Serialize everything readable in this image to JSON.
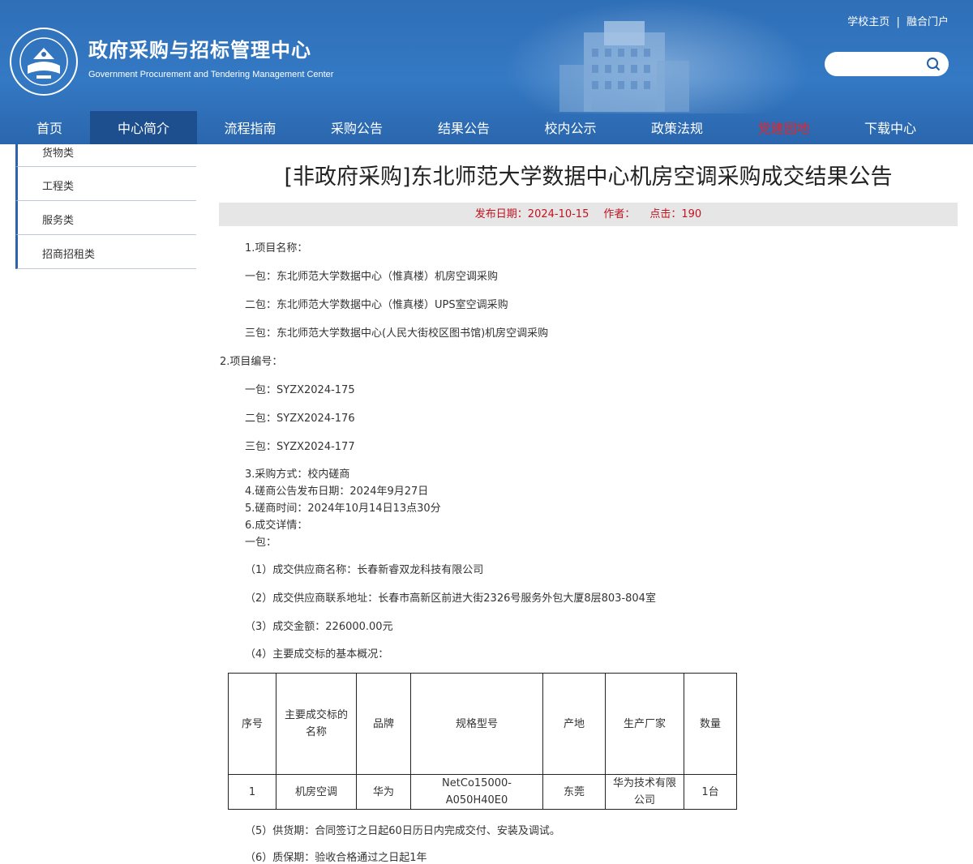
{
  "header": {
    "site_title": "政府采购与招标管理中心",
    "site_subtitle": "Government Procurement and Tendering Management Center",
    "top_links": [
      "学校主页",
      "融合门户"
    ],
    "top_links_separator": "|",
    "search_placeholder": ""
  },
  "nav": {
    "items": [
      "首页",
      "中心简介",
      "流程指南",
      "采购公告",
      "结果公告",
      "校内公示",
      "政策法规",
      "党建园地",
      "下载中心"
    ],
    "active": "中心简介"
  },
  "sidebar": {
    "items": [
      "货物类",
      "工程类",
      "服务类",
      "招商招租类"
    ]
  },
  "article": {
    "title": "[非政府采购]东北师范大学数据中心机房空调采购成交结果公告",
    "meta": {
      "date_label": "发布日期：",
      "date": "2024-10-15",
      "author_label": "作者：",
      "clicks_label": "点击：",
      "clicks": "190"
    },
    "lines": [
      "1.项目名称：",
      "一包：东北师范大学数据中心（惟真楼）机房空调采购",
      "二包：东北师范大学数据中心（惟真楼）UPS室空调采购",
      "三包：东北师范大学数据中心(人民大街校区图书馆)机房空调采购",
      "2.项目编号：",
      "一包：SYZX2024-175",
      "二包：SYZX2024-176",
      "三包：SYZX2024-177",
      "3.采购方式：校内磋商",
      "4.磋商公告发布日期：2024年9月27日",
      "5.磋商时间：2024年10月14日13点30分",
      "6.成交详情：",
      "一包：",
      "（1）成交供应商名称：长春新睿双龙科技有限公司",
      "（2）成交供应商联系地址：长春市高新区前进大街2326号服务外包大厦8层803-804室",
      "（3）成交金额：226000.00元",
      "（4）主要成交标的基本概况：",
      "（5）供货期：合同签订之日起60日历日内完成交付、安装及调试。",
      "（6）质保期：验收合格通过之日起1年"
    ],
    "table": {
      "headers": [
        "序号",
        "主要成交标的名称",
        "品牌",
        "规格型号",
        "产地",
        "生产厂家",
        "数量"
      ],
      "rows": [
        [
          "1",
          "机房空调",
          "华为",
          "NetCo15000-A050H40E0",
          "东莞",
          "华为技术有限公司",
          "1台"
        ]
      ]
    }
  },
  "colors": {
    "header_blue": "#3479c4",
    "nav_active": "#1d4f8f",
    "meta_red": "#c1121f",
    "party_red": "#e0262b"
  }
}
